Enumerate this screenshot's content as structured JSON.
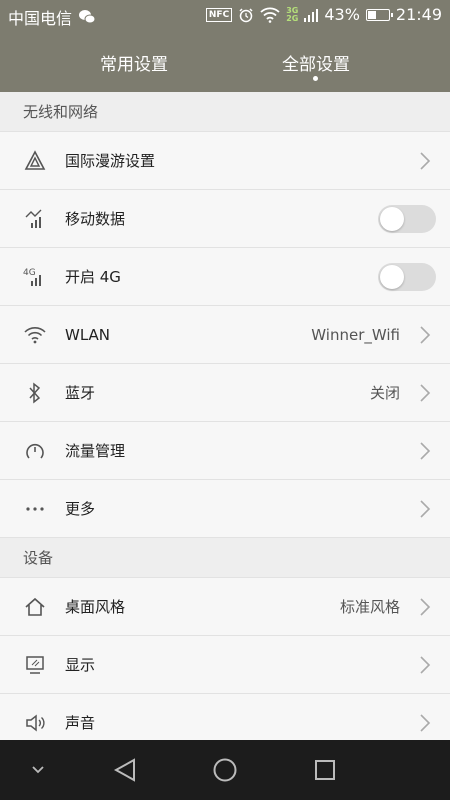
{
  "status_bar": {
    "carrier": "中国电信",
    "nfc": "NFC",
    "net_3g": "3G",
    "net_2g": "2G",
    "battery_level": 43,
    "battery_text": "43%",
    "time": "21:49"
  },
  "tabs": [
    {
      "label": "常用设置"
    },
    {
      "label": "全部设置"
    }
  ],
  "sections": {
    "network": {
      "title": "无线和网络",
      "items": [
        {
          "label": "国际漫游设置",
          "icon": "roaming-icon"
        },
        {
          "label": "移动数据",
          "icon": "mobile-data-icon",
          "toggle": false
        },
        {
          "label": "开启 4G",
          "icon": "4g-icon",
          "toggle": false,
          "icon_text": "4G"
        },
        {
          "label": "WLAN",
          "icon": "wifi-icon",
          "value": "Winner_Wifi"
        },
        {
          "label": "蓝牙",
          "icon": "bluetooth-icon",
          "value": "关闭"
        },
        {
          "label": "流量管理",
          "icon": "traffic-gauge-icon"
        },
        {
          "label": "更多",
          "icon": "more-icon"
        }
      ]
    },
    "device": {
      "title": "设备",
      "items": [
        {
          "label": "桌面风格",
          "icon": "home-style-icon",
          "value": "标准风格"
        },
        {
          "label": "显示",
          "icon": "display-icon"
        },
        {
          "label": "声音",
          "icon": "sound-icon"
        }
      ]
    }
  },
  "colors": {
    "header_bg": "#7d7c6f",
    "list_bg": "#f7f7f7",
    "section_bg": "#eeeeee",
    "navbar_bg": "#1c1c1c",
    "toggle_off": "#dcdcdc"
  }
}
